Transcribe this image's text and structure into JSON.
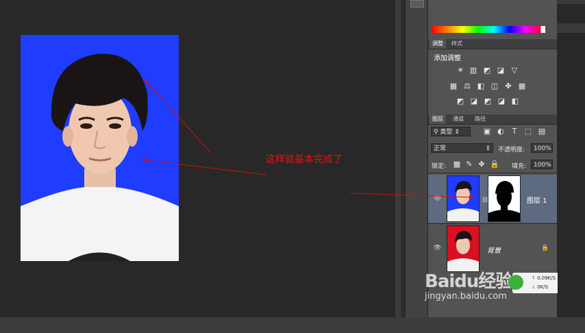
{
  "annotation": {
    "text": "这样就基本完成了"
  },
  "panels": {
    "adjust_tabs": [
      "调整",
      "样式"
    ],
    "adjust_title": "添加调整",
    "layers_tabs": [
      "图层",
      "通道",
      "路径"
    ],
    "kind_filter": "类型",
    "blend_mode": "正常",
    "opacity_label": "不透明度:",
    "opacity_value": "100%",
    "lock_label": "锁定:",
    "fill_label": "填充:",
    "fill_value": "100%",
    "layers": [
      {
        "name": "图层 1",
        "selected": true
      },
      {
        "name": "背景",
        "selected": false
      }
    ]
  },
  "watermark": {
    "logo": "Baidu经验",
    "url": "jingyan.baidu.com"
  },
  "netspeed": {
    "up": "0.09K/S",
    "down": "0K/S"
  },
  "colors": {
    "photo_bg": "#1f3cff",
    "bg_layer_red": "#d81020",
    "annotation": "#e81010",
    "selected_layer": "#5e6a80"
  }
}
